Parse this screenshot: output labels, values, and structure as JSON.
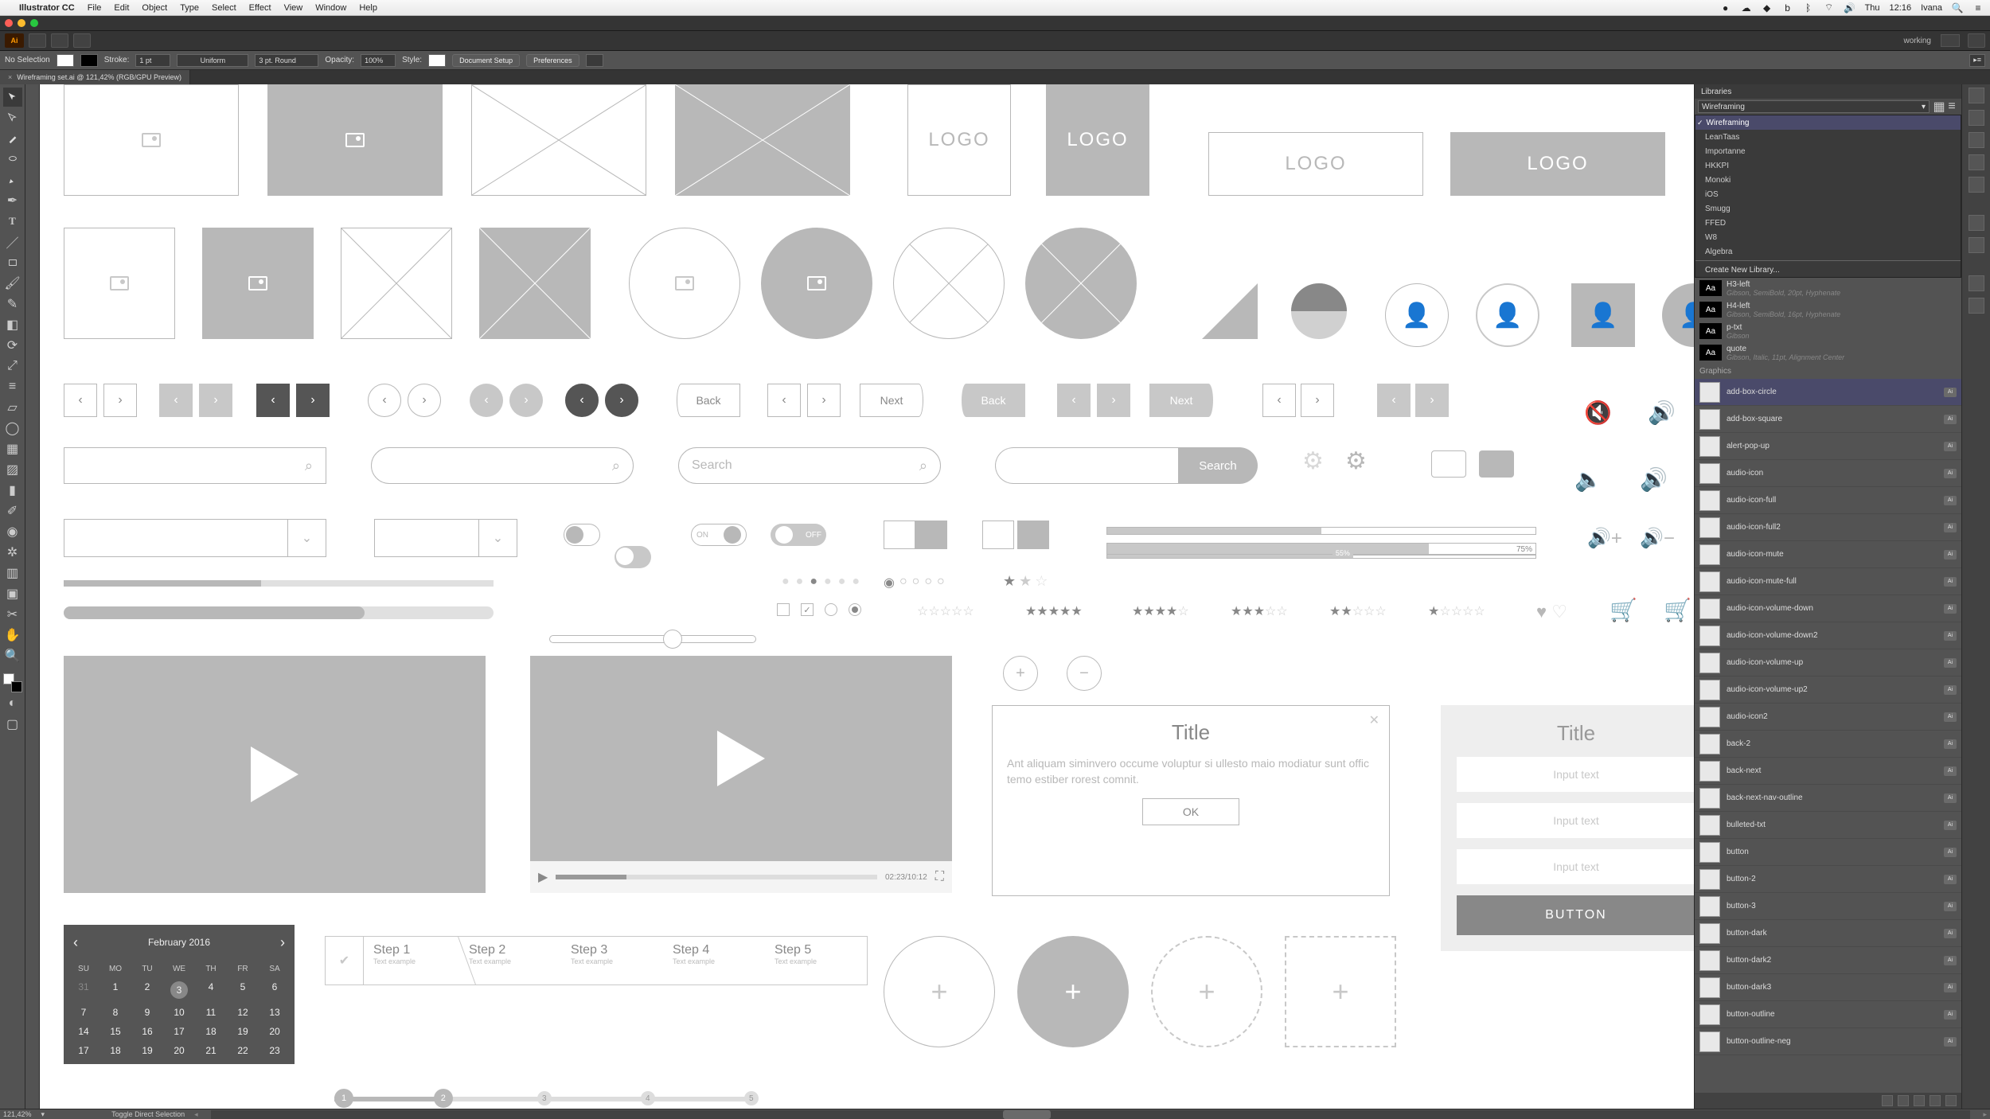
{
  "menubar": {
    "app": "Illustrator CC",
    "items": [
      "File",
      "Edit",
      "Object",
      "Type",
      "Select",
      "Effect",
      "View",
      "Window",
      "Help"
    ],
    "right": {
      "day": "Thu",
      "time": "12:16",
      "user": "Ivana"
    }
  },
  "workspace_label": "working",
  "control_bar": {
    "selection": "No Selection",
    "stroke_label": "Stroke:",
    "stroke_val": "1 pt",
    "profile": "Uniform",
    "brush": "3 pt. Round",
    "opacity_label": "Opacity:",
    "opacity_val": "100%",
    "style_label": "Style:",
    "doc_setup": "Document Setup",
    "preferences": "Preferences"
  },
  "doc_tab": "Wireframing set.ai @ 121,42% (RGB/GPU Preview)",
  "status": {
    "zoom": "121,42%",
    "tip": "Toggle Direct Selection"
  },
  "wf": {
    "logo": "LOGO",
    "back": "Back",
    "next": "Next",
    "search_placeholder": "Search",
    "search_btn": "Search",
    "on": "ON",
    "off": "OFF",
    "progress_75": "75%",
    "progress_55": "55%",
    "video_time": "02:23/10:12",
    "dialog_title": "Title",
    "dialog_body": "Ant aliquam siminvero occume voluptur si ullesto maio modiatur sunt offic temo estiber rorest comnit.",
    "dialog_ok": "OK",
    "form_title": "Title",
    "input_ph": "Input text",
    "button": "BUTTON",
    "steps": [
      {
        "t": "Step 1",
        "s": "Text example"
      },
      {
        "t": "Step 2",
        "s": "Text example"
      },
      {
        "t": "Step 3",
        "s": "Text example"
      },
      {
        "t": "Step 4",
        "s": "Text example"
      },
      {
        "t": "Step 5",
        "s": "Text example"
      }
    ],
    "cal_month": "February  2016",
    "cal_days": [
      "SU",
      "MO",
      "TU",
      "WE",
      "TH",
      "FR",
      "SA"
    ],
    "cal_weeks": [
      [
        "31",
        "1",
        "2",
        "3",
        "4",
        "5",
        "6"
      ],
      [
        "7",
        "8",
        "9",
        "10",
        "11",
        "12",
        "13"
      ],
      [
        "14",
        "15",
        "16",
        "17",
        "18",
        "19",
        "20"
      ],
      [
        "17",
        "18",
        "19",
        "20",
        "21",
        "22",
        "23"
      ]
    ]
  },
  "libraries": {
    "title": "Libraries",
    "current": "Wireframing",
    "options": [
      "Wireframing",
      "LeanTaas",
      "Importanne",
      "HKKPI",
      "Monoki",
      "iOS",
      "Smugg",
      "FFED",
      "W8",
      "Algebra"
    ],
    "create": "Create New Library...",
    "char_styles": [
      {
        "name": "H3-left",
        "sub": "Gibson, SemiBold, 20pt, Hyphenate"
      },
      {
        "name": "H4-left",
        "sub": "Gibson, SemiBold, 16pt, Hyphenate"
      },
      {
        "name": "p-txt",
        "sub": "Gibson"
      },
      {
        "name": "quote",
        "sub": "Gibson, Italic, 11pt, Alignment Center"
      }
    ],
    "graphics_label": "Graphics",
    "graphics": [
      "add-box-circle",
      "add-box-square",
      "alert-pop-up",
      "audio-icon",
      "audio-icon-full",
      "audio-icon-full2",
      "audio-icon-mute",
      "audio-icon-mute-full",
      "audio-icon-volume-down",
      "audio-icon-volume-down2",
      "audio-icon-volume-up",
      "audio-icon-volume-up2",
      "audio-icon2",
      "back-2",
      "back-next",
      "back-next-nav-outline",
      "bulleted-txt",
      "button",
      "button-2",
      "button-3",
      "button-dark",
      "button-dark2",
      "button-dark3",
      "button-outline",
      "button-outline-neg"
    ]
  }
}
